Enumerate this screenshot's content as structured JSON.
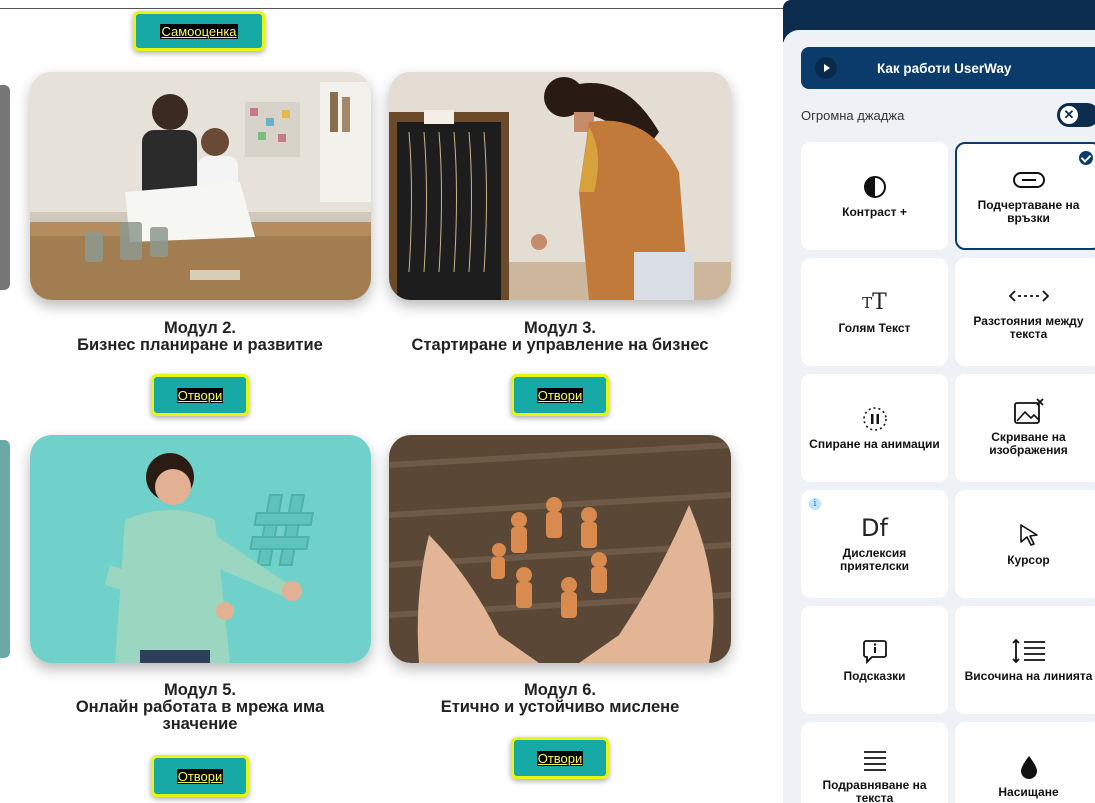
{
  "top": {
    "self_assessment_label": "Самооценка"
  },
  "modules": [
    {
      "number": "Модул 2.",
      "title": "Бизнес планиране и развитие",
      "button": "Отвори"
    },
    {
      "number": "Модул 3.",
      "title": "Стартиране и управление на бизнес",
      "button": "Отвори"
    },
    {
      "number": "Модул 5.",
      "title_line1": "Онлайн работата в мрежа има",
      "title_line2": "значение",
      "button": "Отвори"
    },
    {
      "number": "Модул 6.",
      "title": "Етично и устойчиво мислене",
      "button": "Отвори"
    }
  ],
  "panel": {
    "how_it_works": "Как работи UserWay",
    "oversized_widget": "Огромна джаджа",
    "oversized_widget_on": false,
    "tiles": [
      {
        "label": "Контраст +",
        "icon": "contrast-icon"
      },
      {
        "label": "Подчертаване на връзки",
        "icon": "link-icon",
        "active": true
      },
      {
        "label": "Голям Текст",
        "icon": "text-size-icon"
      },
      {
        "label": "Разстояния между текста",
        "icon": "text-spacing-icon"
      },
      {
        "label": "Спиране на анимации",
        "icon": "pause-animation-icon"
      },
      {
        "label": "Скриване на изображения",
        "icon": "hide-image-icon"
      },
      {
        "label": "Дислексия приятелски",
        "icon": "dyslexia-icon",
        "glyph": "Df"
      },
      {
        "label": "Курсор",
        "icon": "cursor-icon"
      },
      {
        "label": "Подсказки",
        "icon": "tooltip-icon"
      },
      {
        "label": "Височина на линията",
        "icon": "line-height-icon"
      },
      {
        "label": "Подравняване на текста",
        "icon": "text-align-icon"
      },
      {
        "label": "Насищане",
        "icon": "saturation-icon"
      }
    ]
  },
  "colors": {
    "button_bg": "#16a9a6",
    "button_border": "#e8f50e",
    "panel_dark": "#0b2c4d",
    "panel_bg": "#eef1f6"
  }
}
